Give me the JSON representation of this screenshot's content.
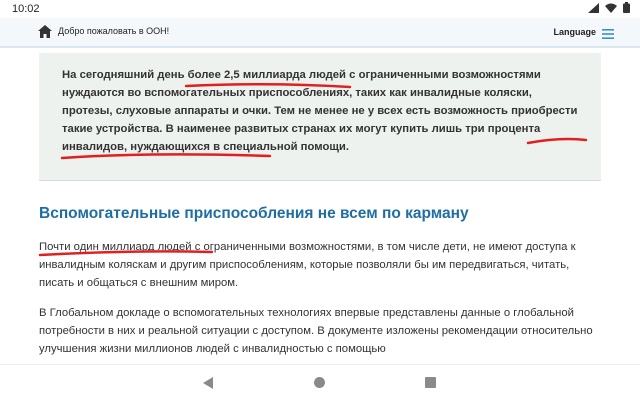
{
  "status_bar": {
    "time": "10:02",
    "icons": [
      "signal-icon",
      "wifi-icon",
      "battery-icon"
    ]
  },
  "header": {
    "welcome": "Добро пожаловать в ООН!",
    "language": "Language",
    "icons": [
      "home-icon",
      "menu-icon"
    ]
  },
  "callout": {
    "text": "На сегодняшний день более 2,5 миллиарда людей с ограниченными возможностями нуждаются во вспомогательных приспособлениях, таких как инвалидные коляски, протезы, слуховые аппараты и очки. Тем не менее не у всех есть возможность приобрести такие устройства. В наименее развитых странах их могут купить лишь три процента инвалидов, нуждающихся в специальной помощи."
  },
  "section": {
    "title": "Вспомогательные приспособления не всем по карману",
    "paragraph_1": "Почти один миллиард людей с ограниченными возможностями, в том числе дети, не имеют доступа к инвалидным коляскам и другим приспособлениям, которые позволяли бы им передвигаться, читать, писать и общаться с внешним миром.",
    "paragraph_2": "В Глобальном докладе о вспомогательных технологиях впервые представлены данные о глобальной потребности в них и реальной ситуации с доступом. В документе изложены рекомендации относительно улучшения жизни миллионов людей с инвалидностью с помощью"
  },
  "colors": {
    "accent": "#1f6ea3",
    "underline_mark": "#e02020",
    "callout_bg": "#eef2ee"
  },
  "nav_bar": {
    "icons": [
      "back-icon",
      "home-circle-icon",
      "recents-icon"
    ]
  }
}
